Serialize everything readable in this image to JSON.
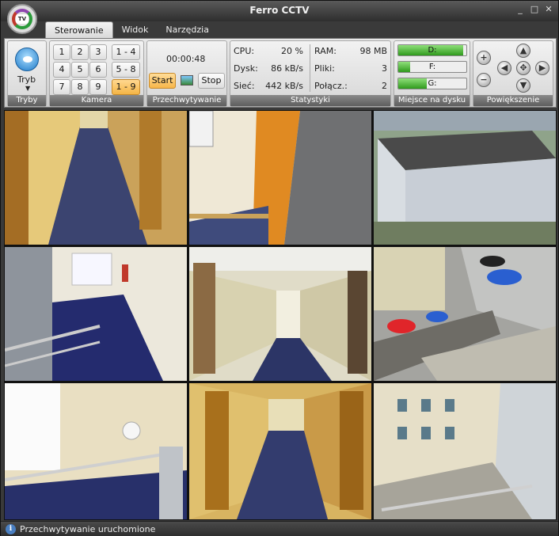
{
  "window": {
    "title": "Ferro CCTV",
    "logo_text": "TV",
    "controls": [
      "minimize-icon",
      "maximize-icon",
      "close-icon"
    ]
  },
  "tabs": [
    {
      "label": "Sterowanie",
      "active": true
    },
    {
      "label": "Widok",
      "active": false
    },
    {
      "label": "Narzędzia",
      "active": false
    }
  ],
  "groups": {
    "tryby": {
      "label": "Tryby",
      "button_label": "Tryb",
      "icon": "eye-icon"
    },
    "kamera": {
      "label": "Kamera",
      "cams": [
        "1",
        "2",
        "3",
        "4",
        "5",
        "6",
        "7",
        "8",
        "9"
      ],
      "ranges": [
        {
          "label": "1 - 4",
          "active": false
        },
        {
          "label": "5 - 8",
          "active": false
        },
        {
          "label": "1 - 9",
          "active": true
        }
      ]
    },
    "przechwytywanie": {
      "label": "Przechwytywanie",
      "timer": "00:00:48",
      "start_label": "Start",
      "stop_label": "Stop",
      "snapshot_icon": "image-icon"
    },
    "statystyki": {
      "label": "Statystyki",
      "cpu_label": "CPU:",
      "cpu_value": "20 %",
      "dysk_label": "Dysk:",
      "dysk_value": "86 kB/s",
      "siec_label": "Sieć:",
      "siec_value": "442 kB/s",
      "ram_label": "RAM:",
      "ram_value": "98 MB",
      "pliki_label": "Pliki:",
      "pliki_value": "3",
      "polacz_label": "Połącz.:",
      "polacz_value": "2"
    },
    "dysk": {
      "label": "Miejsce na dysku",
      "drives": [
        {
          "name": "D:",
          "fill": 0.95
        },
        {
          "name": "F:",
          "fill": 0.18
        },
        {
          "name": "G:",
          "fill": 0.42
        }
      ]
    },
    "powiekszenie": {
      "label": "Powiększenie"
    }
  },
  "status": {
    "text": "Przechwytywanie uruchomione"
  },
  "colors": {
    "accent_bar": "#2f9a1c",
    "ribbon_label": "#5e5e5e",
    "active_button": "#f5b546"
  }
}
